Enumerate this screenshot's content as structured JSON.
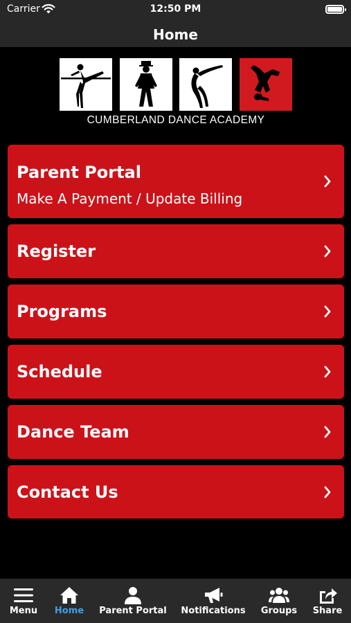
{
  "status_bar": {
    "carrier": "Carrier",
    "time": "12:50 PM",
    "battery_level": 1.0
  },
  "header": {
    "title": "Home"
  },
  "logo": {
    "text": "CUMBERLAND DANCE ACADEMY",
    "accent_color": "#d11a20"
  },
  "menu": {
    "items": [
      {
        "label": "Parent Portal",
        "subtitle": "Make A Payment / Update Billing"
      },
      {
        "label": "Register"
      },
      {
        "label": "Programs"
      },
      {
        "label": "Schedule"
      },
      {
        "label": "Dance Team"
      },
      {
        "label": "Contact Us"
      }
    ],
    "button_color": "#cc1219"
  },
  "tabbar": {
    "active_color": "#3ea0e8",
    "items": [
      {
        "label": "Menu",
        "icon": "hamburger-icon"
      },
      {
        "label": "Home",
        "icon": "home-icon",
        "active": true
      },
      {
        "label": "Parent Portal",
        "icon": "user-icon"
      },
      {
        "label": "Notifications",
        "icon": "megaphone-icon"
      },
      {
        "label": "Groups",
        "icon": "group-icon"
      },
      {
        "label": "Share",
        "icon": "share-icon"
      }
    ]
  }
}
